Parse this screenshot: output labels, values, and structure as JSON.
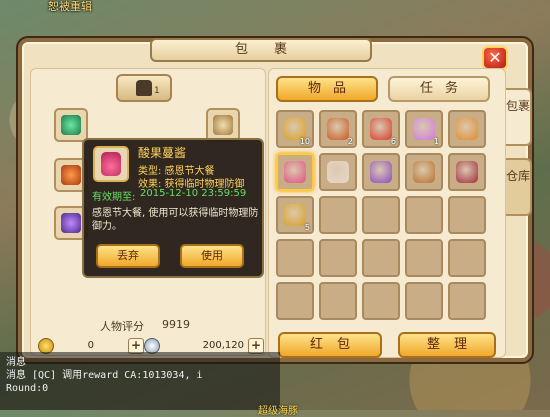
{
  "scene": {
    "top_label": "恕被重辑",
    "bottom_name": "超级海豚"
  },
  "window": {
    "title": "包裹",
    "close_symbol": "✕"
  },
  "character": {
    "rating_label": "人物评分",
    "rating_value": "9919",
    "head_badge": "1",
    "currency": {
      "gold": "0",
      "silver": "200,120",
      "plus_symbol": "+"
    }
  },
  "tabs": [
    {
      "label": "物品",
      "active": true
    },
    {
      "label": "任务",
      "active": false
    }
  ],
  "side_tabs": [
    {
      "label": "包裹",
      "active": true
    },
    {
      "label": "仓库",
      "active": false
    }
  ],
  "items": [
    {
      "icon": "gift-bag-icon",
      "color": "#d8a020",
      "count": "10"
    },
    {
      "icon": "lucky-bag-icon",
      "color": "#c85a20",
      "count": "2"
    },
    {
      "icon": "red-envelope-icon",
      "color": "#d83a2a",
      "count": "6"
    },
    {
      "icon": "gift-box-icon",
      "color": "#d07adf",
      "count": "1"
    },
    {
      "icon": "pie-icon",
      "color": "#e08a2a",
      "count": ""
    },
    {
      "icon": "jam-jar-icon",
      "color": "#e05080",
      "count": "",
      "selected": true
    },
    {
      "icon": "dumpling-icon",
      "color": "#e8d8c8",
      "count": ""
    },
    {
      "icon": "feather-icon",
      "color": "#8a4ac0",
      "count": ""
    },
    {
      "icon": "scroll-icon",
      "color": "#b8702a",
      "count": ""
    },
    {
      "icon": "bead-string-icon",
      "color": "#a02a3a",
      "count": ""
    },
    {
      "icon": "gourd-icon",
      "color": "#d8a020",
      "count": "5"
    }
  ],
  "buttons": {
    "red_envelope": "红包",
    "tidy": "整理"
  },
  "tooltip": {
    "name": "酸果蔓酱",
    "type_line": "类型: 感恩节大餐",
    "effect_line": "效果: 获得临时物理防御",
    "expiry_label": "有效期至:",
    "expiry": "2015-12-10 23:59:59",
    "description": "感恩节大餐, 使用可以获得临时物理防御力。",
    "discard": "丢弃",
    "use": "使用"
  },
  "chat": {
    "lines": [
      "消息",
      "消息 [QC] 调用reward CA:1013034, i",
      "Round:0"
    ]
  }
}
